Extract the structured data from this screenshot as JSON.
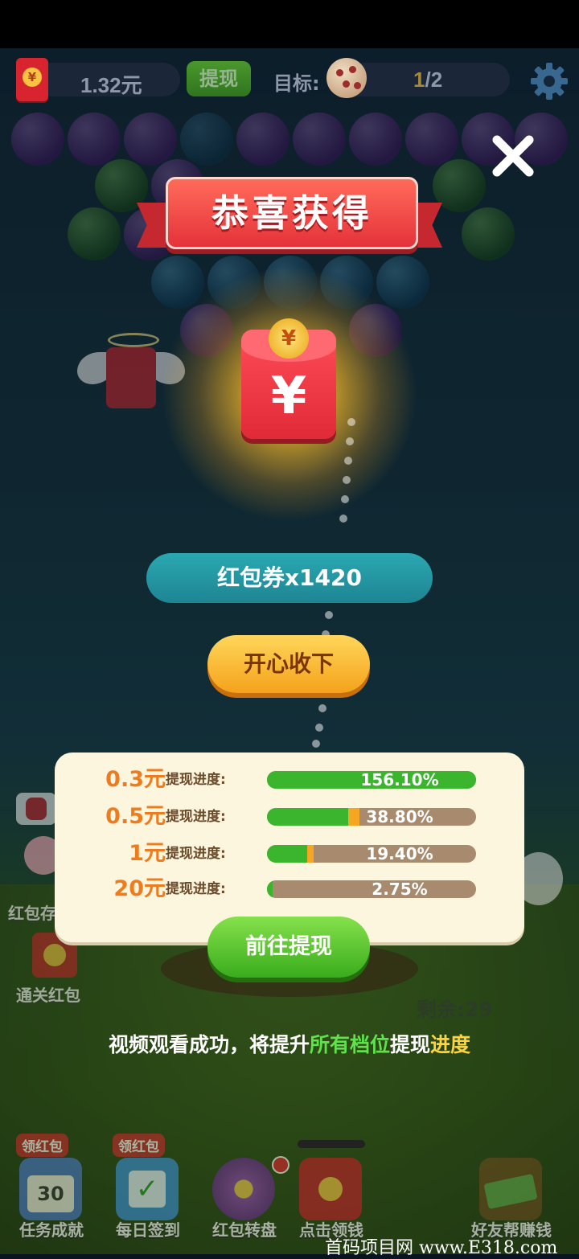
{
  "topbar": {
    "money": "1.32元",
    "withdraw_label": "提现",
    "target_label": "目标:",
    "target_current": "1",
    "target_total": "/2"
  },
  "reward": {
    "title": "恭喜获得",
    "yen_symbol": "¥",
    "coupon_text": "红包券x1420",
    "accept_label": "开心收下"
  },
  "progress": {
    "rows": [
      {
        "amount": "0.3元",
        "label": "提现进度:",
        "percent_text": "156.10%",
        "fill": 1.0
      },
      {
        "amount": "0.5元",
        "label": "提现进度:",
        "percent_text": "38.80%",
        "fill": 0.388
      },
      {
        "amount": "1元",
        "label": "提现进度:",
        "percent_text": "19.40%",
        "fill": 0.194
      },
      {
        "amount": "20元",
        "label": "提现进度:",
        "percent_text": "2.75%",
        "fill": 0.0275
      }
    ],
    "go_label": "前往提现"
  },
  "remaining": "剩余:29",
  "tip": {
    "part1": "视频观看成功，将提升",
    "part2": "所有档位",
    "part3": "提现",
    "part4": "进度"
  },
  "side": {
    "left_top_label": "红包存",
    "left_bottom_label": "通关红包"
  },
  "nav": {
    "items": [
      {
        "label": "任务成就",
        "badge": "领红包",
        "date": "30"
      },
      {
        "label": "每日签到",
        "badge": "领红包"
      },
      {
        "label": "红包转盘"
      },
      {
        "label": "点击领钱"
      },
      {
        "label": "好友帮赚钱"
      }
    ]
  },
  "watermark": "首码项目网 www.E318.com",
  "colors": {
    "accent_green": "#3bb52e",
    "accent_orange": "#ee7b1d",
    "coupon_teal": "#1e8592",
    "ribbon_red": "#e5323a"
  }
}
